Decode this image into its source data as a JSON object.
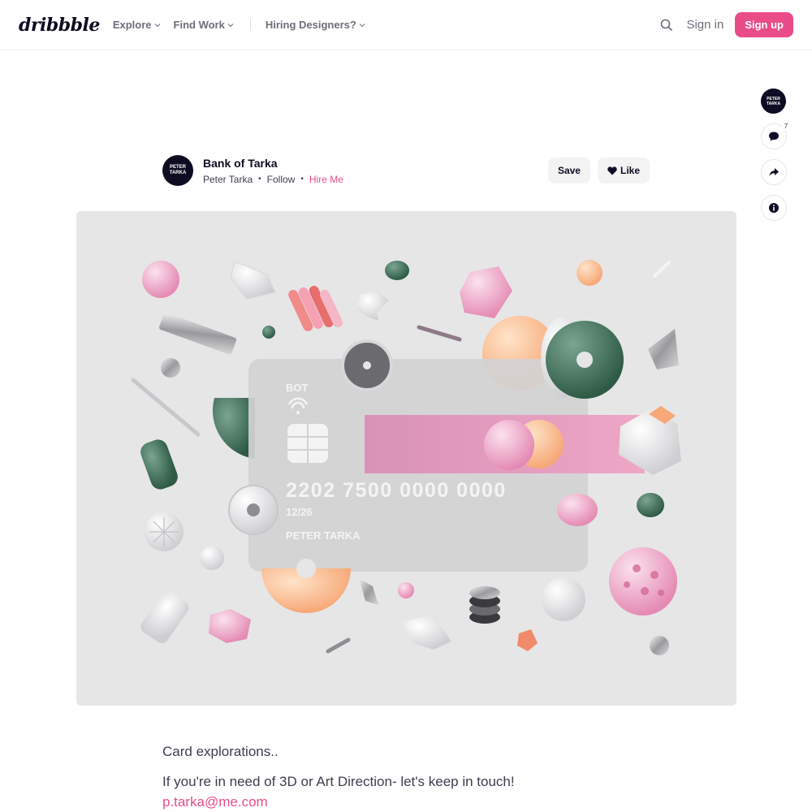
{
  "header": {
    "logo": "dribbble",
    "nav": [
      {
        "label": "Explore"
      },
      {
        "label": "Find Work"
      },
      {
        "label": "Hiring Designers?"
      }
    ],
    "sign_in": "Sign in",
    "sign_up": "Sign up"
  },
  "rail": {
    "avatar_text": "PETER TARKA",
    "comment_count": "7",
    "icons": [
      "comment-icon",
      "share-icon",
      "info-icon"
    ]
  },
  "shot": {
    "title": "Bank of Tarka",
    "author": "Peter Tarka",
    "follow": "Follow",
    "hire": "Hire Me",
    "avatar_text": "PETER TARKA",
    "save": "Save",
    "like": "Like"
  },
  "card": {
    "brand": "BOT",
    "number": "2202 7500 0000 0000",
    "expiry": "12/26",
    "holder": "PETER TARKA"
  },
  "description": {
    "line1": "Card explorations..",
    "line2": "If you're in need of 3D or Art Direction- let's keep in touch!",
    "email": "p.tarka@me.com"
  },
  "colors": {
    "accent": "#ea4c89",
    "ink": "#0d0c22",
    "shot_bg": "#e6e6e7"
  }
}
